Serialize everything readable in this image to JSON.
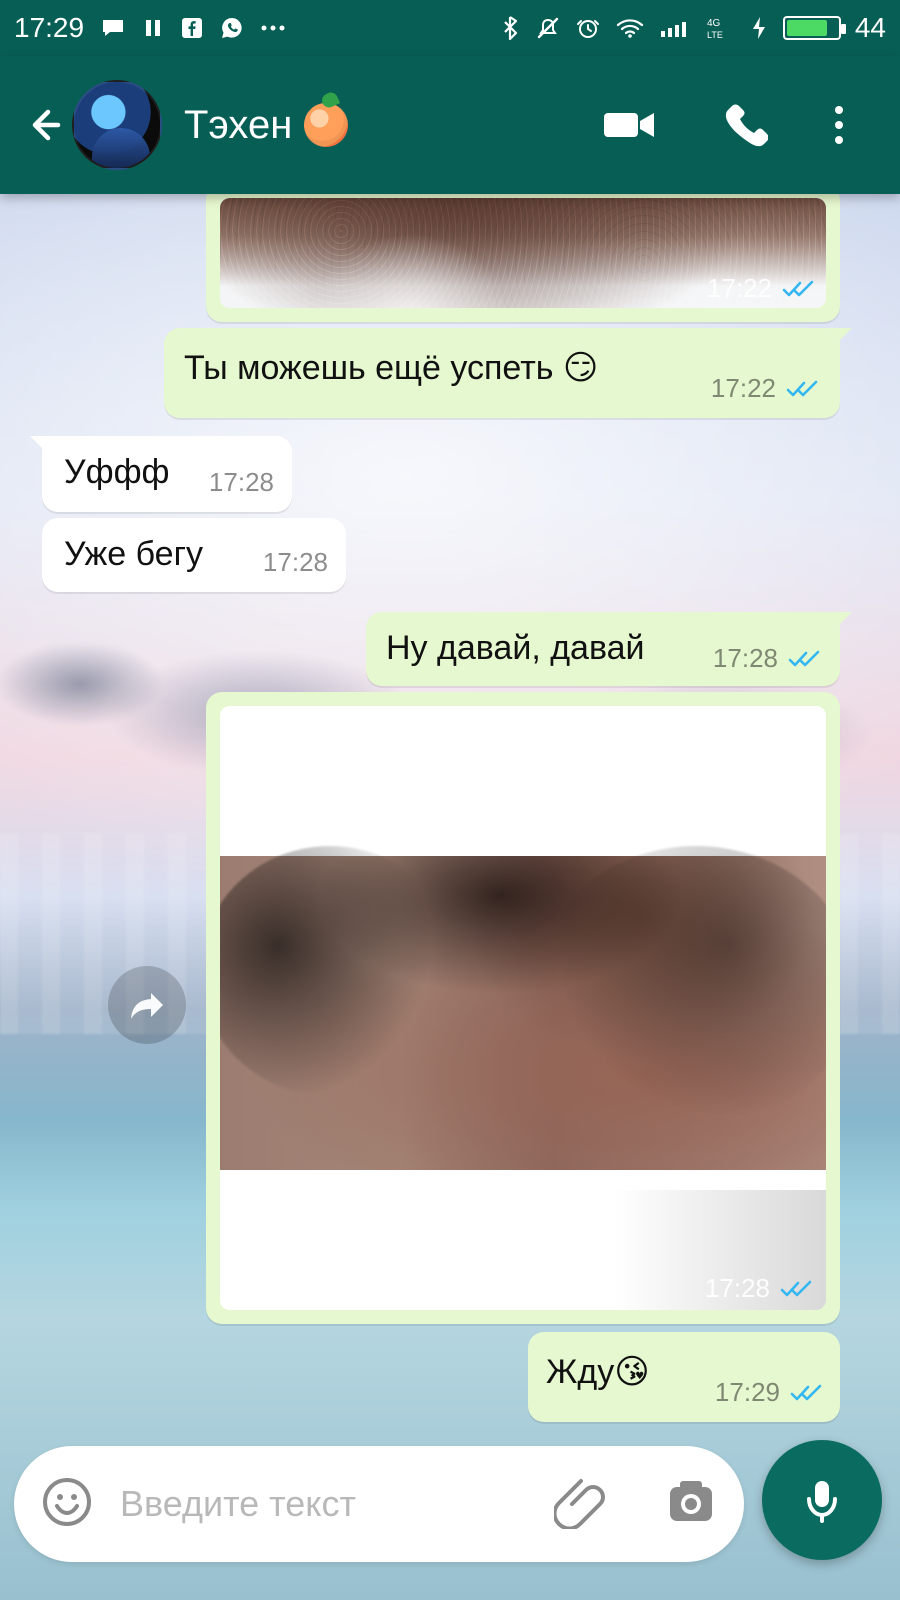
{
  "status_bar": {
    "time": "17:29",
    "right_value": "44"
  },
  "header": {
    "contact_name": "Тэхен"
  },
  "messages": [
    {
      "direction": "out",
      "type": "image",
      "time": "17:22",
      "status": "read"
    },
    {
      "direction": "out",
      "type": "text",
      "text": "Ты можешь ещё успеть 😏",
      "time": "17:22",
      "status": "read"
    },
    {
      "direction": "in",
      "type": "text",
      "text": "Уффф",
      "time": "17:28"
    },
    {
      "direction": "in",
      "type": "text",
      "text": "Уже бегу",
      "time": "17:28"
    },
    {
      "direction": "out",
      "type": "text",
      "text": "Ну давай, давай",
      "time": "17:28",
      "status": "read"
    },
    {
      "direction": "out",
      "type": "image",
      "time": "17:28",
      "status": "read"
    },
    {
      "direction": "out",
      "type": "text",
      "text": "Жду😘",
      "time": "17:29",
      "status": "read"
    }
  ],
  "composer": {
    "placeholder": "Введите текст"
  },
  "colors": {
    "header": "#075E54",
    "bubble_out": "#E6F8CF",
    "bubble_in": "#FFFFFF",
    "read_ticks": "#34B7F1"
  },
  "icons": {
    "back": "back-arrow-icon",
    "video": "video-call-icon",
    "phone": "voice-call-icon",
    "more": "more-vertical-icon",
    "emoji": "emoji-icon",
    "attach": "attachment-icon",
    "camera": "camera-icon",
    "mic": "microphone-icon",
    "forward": "forward-icon",
    "ticks": "double-check-icon"
  }
}
